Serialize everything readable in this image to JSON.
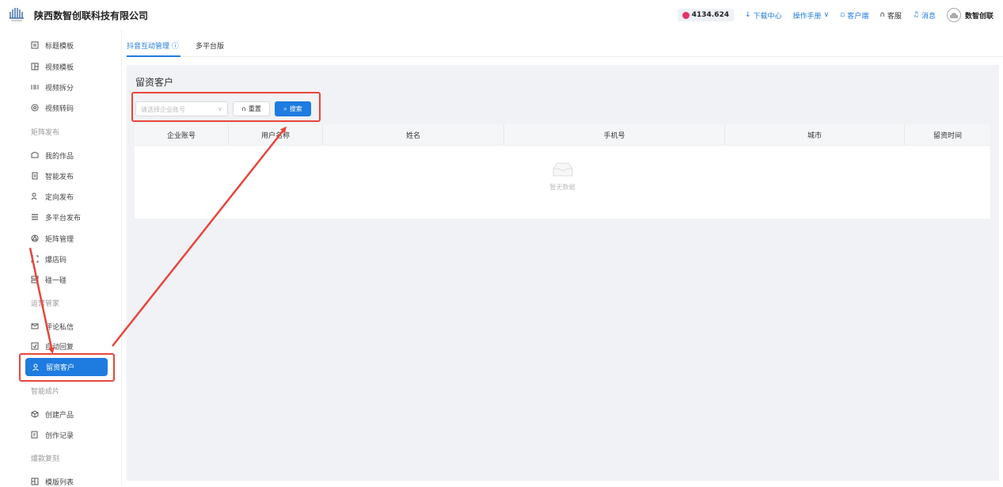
{
  "header": {
    "company": "陕西数智创联科技有限公司",
    "balance": "4134.624",
    "download_center": "下载中心",
    "manual": "操作手册",
    "customer_end": "客户端",
    "service": "客服",
    "messages": "消息",
    "user_name": "数智创联"
  },
  "sidebar": {
    "items_top": [
      "标题模板",
      "视频模板",
      "视频拆分",
      "视频转码"
    ],
    "group_matrix": "矩阵发布",
    "items_matrix": [
      "我的作品",
      "智能发布",
      "定向发布",
      "多平台发布",
      "矩阵管理",
      "爆店码",
      "碰一碰"
    ],
    "group_ops": "运营管家",
    "items_ops": [
      "评论私信",
      "自动回复"
    ],
    "active_item": "留资客户",
    "group_smart": "智能成片",
    "items_smart": [
      "创建产品",
      "创作记录"
    ],
    "group_copy": "爆款复刻",
    "items_copy": [
      "模版列表"
    ]
  },
  "tabs": {
    "tab1": "抖音互动管理",
    "tab2": "多平台版"
  },
  "main": {
    "title": "留资客户",
    "select_placeholder": "请选择企业账号",
    "reset_label": "重置",
    "search_label": "搜索",
    "columns": [
      "企业账号",
      "用户名称",
      "姓名",
      "手机号",
      "城市",
      "留资时间"
    ],
    "empty_text": "暂无数据"
  },
  "colors": {
    "accent": "#1e7be0",
    "annotation": "#e8453c"
  }
}
